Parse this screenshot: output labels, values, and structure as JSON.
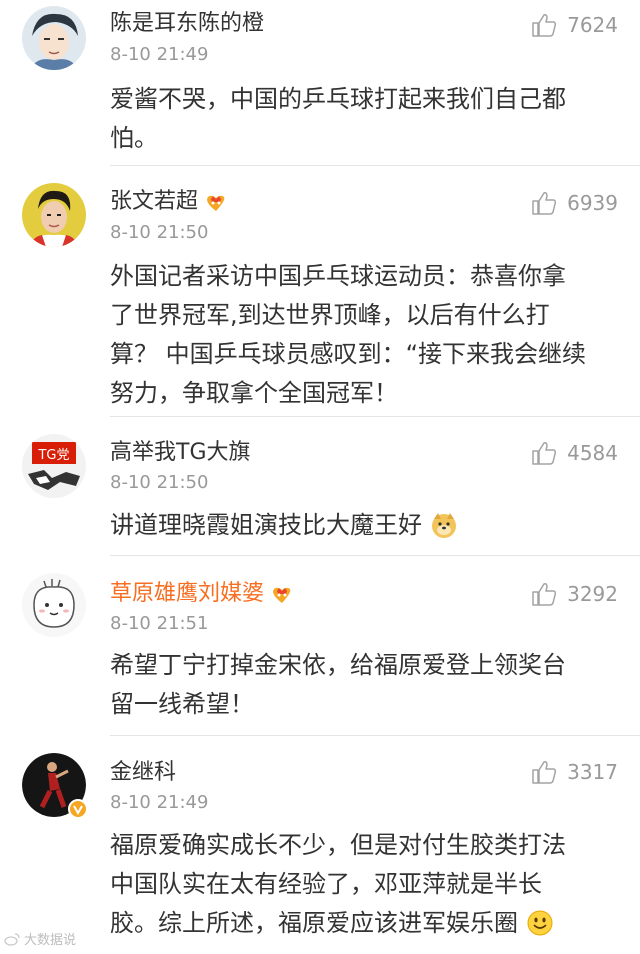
{
  "comments": [
    {
      "username": "陈是耳东陈的橙",
      "time": "8-10 21:49",
      "likes": "7624",
      "lines": [
        "爱酱不哭，中国的乒乓球打起来我们自己都",
        "怕。"
      ]
    },
    {
      "username": "张文若超",
      "time": "8-10 21:50",
      "likes": "6939",
      "lines": [
        "外国记者采访中国乒乓球运动员：恭喜你拿",
        "了世界冠军,到达世界顶峰，以后有什么打",
        "算？ 中国乒乓球员感叹到：“接下来我会继续",
        "努力，争取拿个全国冠军！"
      ]
    },
    {
      "username": "高举我TG大旗",
      "avatar_text": "TG党",
      "time": "8-10 21:50",
      "likes": "4584",
      "lines": [
        "讲道理晓霞姐演技比大魔王好"
      ]
    },
    {
      "username": "草原雄鹰刘媒婆",
      "time": "8-10 21:51",
      "likes": "3292",
      "lines": [
        "希望丁宁打掉金宋依，给福原爱登上领奖台",
        "留一线希望！"
      ]
    },
    {
      "username": "金继科",
      "time": "8-10 21:49",
      "likes": "3317",
      "lines": [
        "福原爱确实成长不少，但是对付生胶类打法",
        "中国队实在太有经验了，邓亚萍就是半长",
        "胶。综上所述，福原爱应该进军娱乐圈"
      ]
    }
  ],
  "watermark": "大数据说",
  "colors": {
    "vip_name": "#f86e21",
    "text": "#333333",
    "meta": "#999999",
    "divider": "#e5e5e5",
    "verified": "#f5a623"
  },
  "icons": {
    "like": "thumbs-up-icon",
    "vip_badge": "heart-crown-icon",
    "verified": "verified-v-icon",
    "doge": "doge-emoji",
    "smile": "smile-emoji"
  }
}
